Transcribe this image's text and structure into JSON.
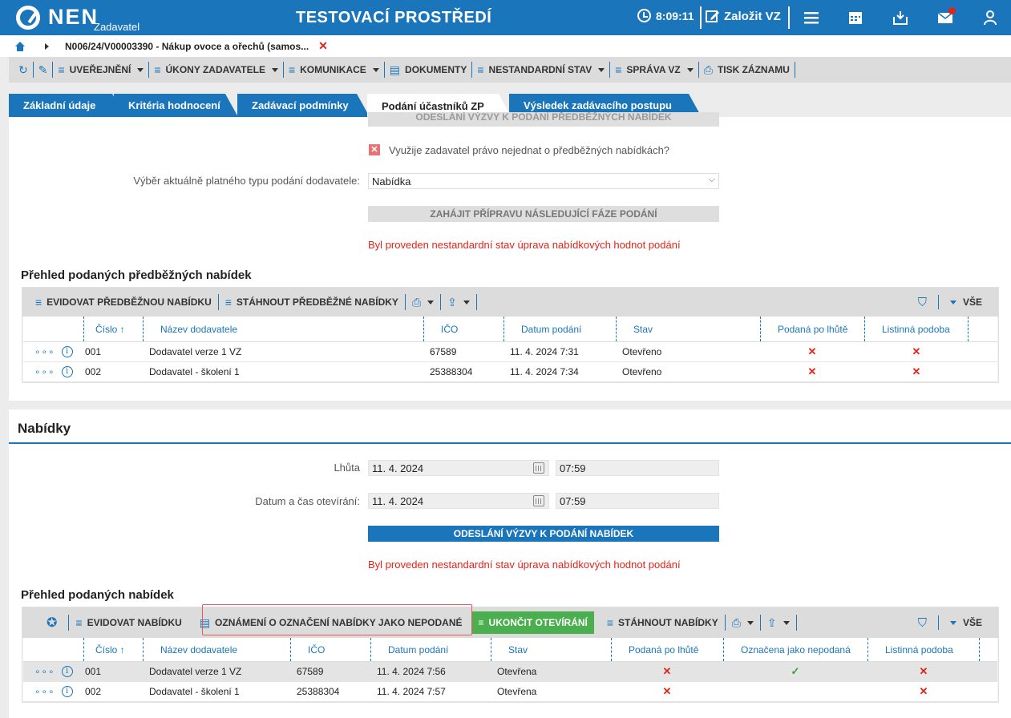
{
  "topbar": {
    "logo": "NEN",
    "logo_sub": "Zadavatel",
    "env_title": "TESTOVACÍ PROSTŘEDÍ",
    "time": "8:09:11",
    "create_label": "Založit VZ",
    "colors": {
      "primary": "#1b75bb",
      "notification": "#e2231a"
    }
  },
  "breadcrumb": {
    "text": "N006/24/V00003390 - Nákup ovoce a ořechů (samos..."
  },
  "toolbar": {
    "items": [
      "UVEŘEJNĚNÍ",
      "ÚKONY ZADAVATELE",
      "KOMUNIKACE",
      "DOKUMENTY",
      "NESTANDARDNÍ STAV",
      "SPRÁVA VZ",
      "TISK ZÁZNAMU"
    ]
  },
  "tabs": [
    "Základní údaje",
    "Kritéria hodnocení",
    "Zadávací podmínky",
    "Podání účastníků ZP",
    "Výsledek zadávacího postupu"
  ],
  "prelim": {
    "cut_button": "ODESLÁNÍ VÝZVY K PODÁNÍ PŘEDBĚŽNÝCH NABÍDEK",
    "checkbox_label": "Využije zadavatel právo nejednat o předběžných nabídkách?",
    "type_label": "Výběr aktuálně platného typu podání dodavatele:",
    "type_value": "Nabídka",
    "next_phase_button": "ZAHÁJIT PŘÍPRAVU NÁSLEDUJÍCÍ FÁZE PODÁNÍ",
    "warning": "Byl proveden nestandardní stav úprava nabídkových hodnot podání",
    "grid_title": "Přehled podaných předběžných nabídek",
    "tool_add": "EVIDOVAT PŘEDBĚŽNOU NABÍDKU",
    "tool_download": "STÁHNOUT PŘEDBĚŽNÉ NABÍDKY",
    "tool_all": "VŠE",
    "columns": [
      "Číslo",
      "Název dodavatele",
      "IČO",
      "Datum podání",
      "Stav",
      "Podaná po lhůtě",
      "Listinná podoba"
    ],
    "rows": [
      {
        "cislo": "001",
        "nazev": "Dodavatel verze 1 VZ",
        "ico": "67589",
        "datum": "11. 4. 2024 7:31",
        "stav": "Otevřeno"
      },
      {
        "cislo": "002",
        "nazev": "Dodavatel - školení 1",
        "ico": "25388304",
        "datum": "11. 4. 2024 7:34",
        "stav": "Otevřeno"
      }
    ]
  },
  "offers": {
    "section_title": "Nabídky",
    "deadline_label": "Lhůta",
    "deadline_date": "11. 4. 2024",
    "deadline_time": "07:59",
    "open_label": "Datum a čas otevírání:",
    "open_date": "11. 4. 2024",
    "open_time": "07:59",
    "send_button": "ODESLÁNÍ VÝZVY K PODÁNÍ NABÍDEK",
    "warning": "Byl proveden nestandardní stav úprava nabídkových hodnot podání",
    "grid_title": "Přehled podaných nabídek",
    "tool_add": "EVIDOVAT NABÍDKU",
    "tool_notice": "OZNÁMENÍ O OZNAČENÍ NABÍDKY JAKO NEPODANÉ",
    "tool_finish": "UKONČIT OTEVÍRÁNÍ",
    "tool_download": "STÁHNOUT NABÍDKY",
    "tool_all": "VŠE",
    "columns": [
      "Číslo",
      "Název dodavatele",
      "IČO",
      "Datum podání",
      "Stav",
      "Podaná po lhůtě",
      "Označena jako nepodaná",
      "Listinná podoba"
    ],
    "rows": [
      {
        "cislo": "001",
        "nazev": "Dodavatel verze 1 VZ",
        "ico": "67589",
        "datum": "11. 4. 2024 7:56",
        "stav": "Otevřena"
      },
      {
        "cislo": "002",
        "nazev": "Dodavatel - školení 1",
        "ico": "25388304",
        "datum": "11. 4. 2024 7:57",
        "stav": "Otevřena"
      }
    ]
  }
}
